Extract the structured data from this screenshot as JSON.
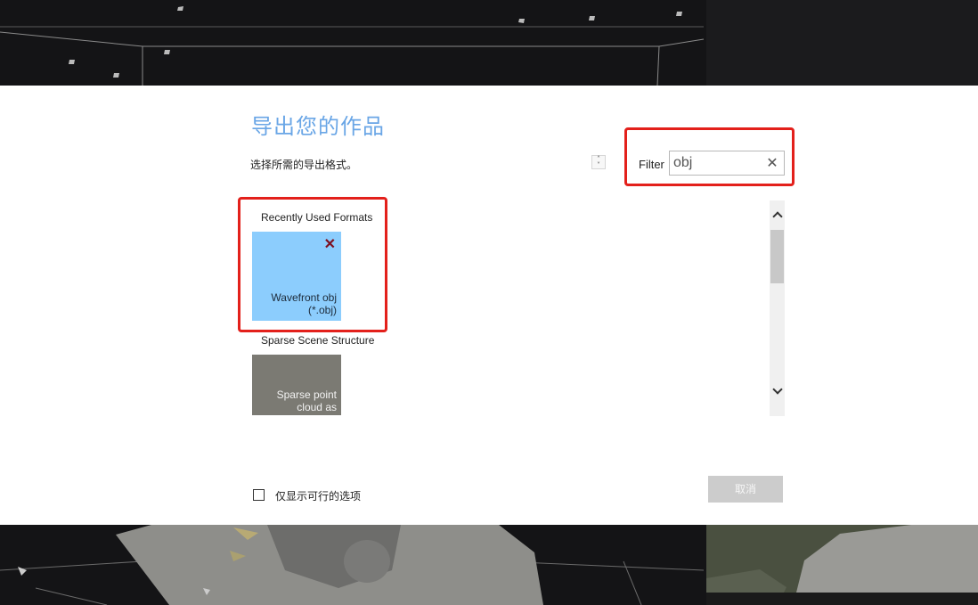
{
  "dialog": {
    "title": "导出您的作品",
    "subtitle": "选择所需的导出格式。",
    "sort_arrows": "⌃⌄",
    "filter": {
      "label": "Filter",
      "value": "obj",
      "clear_glyph": "✕"
    },
    "groups": [
      {
        "heading": "Recently Used Formats",
        "tiles": [
          {
            "line1": "Wavefront obj",
            "line2": "(*.obj)",
            "remove_glyph": "✕",
            "color": "#8ccdfd"
          }
        ]
      },
      {
        "heading": "Sparse Scene Structure",
        "tiles": [
          {
            "line1": "Sparse point",
            "line2": "cloud as",
            "color": "#7b7a73"
          }
        ]
      }
    ],
    "checkbox": {
      "label": "仅显示可行的选项",
      "checked": false
    },
    "cancel_label": "取消"
  },
  "colors": {
    "title": "#6aa6e6",
    "highlight": "#e3201b",
    "background": "#141416"
  },
  "icons": [
    "close-icon",
    "chevron-up-icon",
    "chevron-down-icon",
    "sort-arrows-icon"
  ]
}
